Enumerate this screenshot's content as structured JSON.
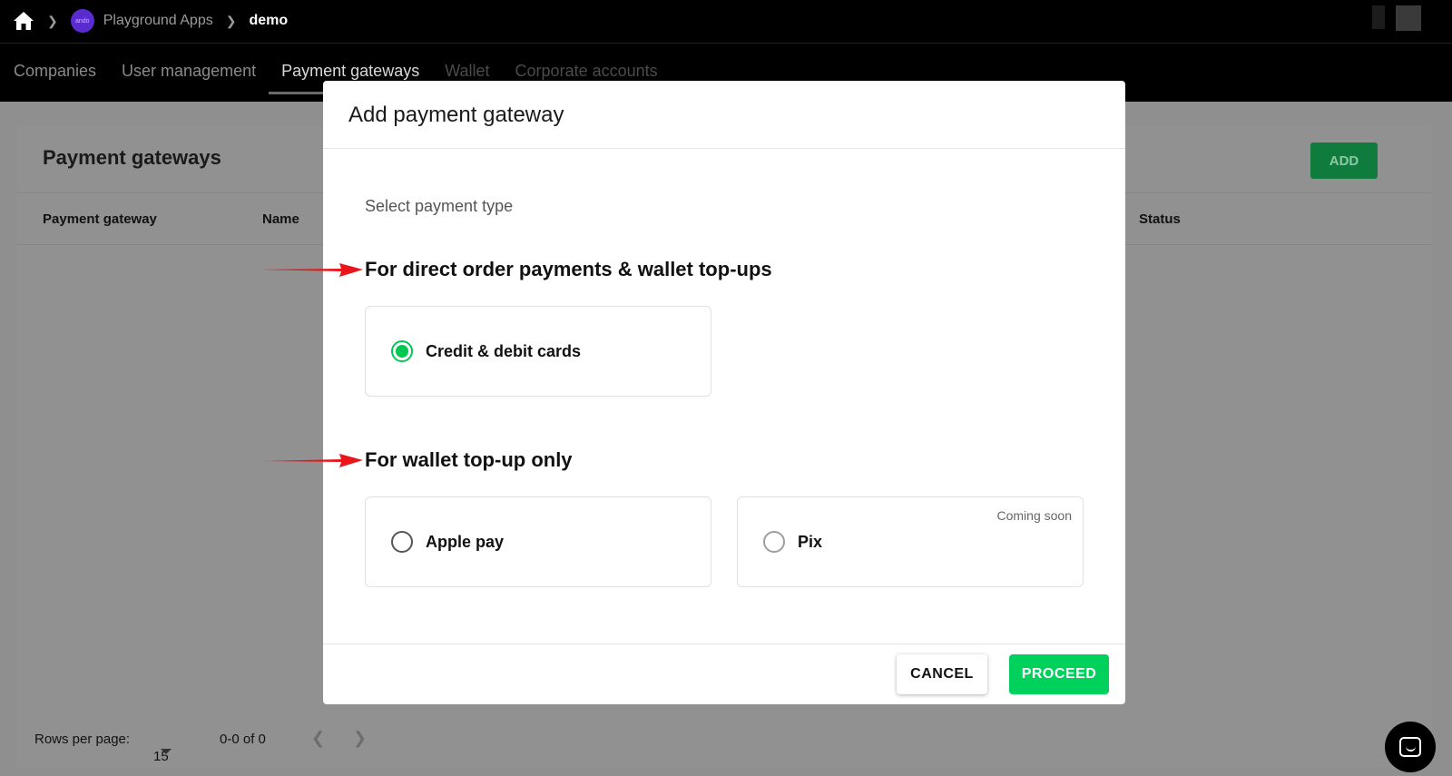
{
  "breadcrumb": {
    "home_icon": "home-icon",
    "org_name": "Playground Apps",
    "org_logo_text": "ando",
    "current": "demo"
  },
  "tabs": [
    "Companies",
    "User management",
    "Payment gateways",
    "Wallet",
    "Corporate accounts"
  ],
  "page": {
    "title": "Payment gateways",
    "add_label": "ADD",
    "columns": [
      "Payment gateway",
      "Name",
      "Status"
    ],
    "rows_per_page_label": "Rows per page:",
    "rows_per_page_value": "15",
    "range": "0-0 of 0",
    "prev_icon": "chevron-left-icon",
    "next_icon": "chevron-right-icon"
  },
  "modal": {
    "title": "Add payment gateway",
    "subtitle": "Select payment type",
    "section1": "For direct order payments & wallet top-ups",
    "section2": "For wallet top-up only",
    "options": [
      {
        "label": "Credit & debit cards",
        "selected": true,
        "badge": ""
      },
      {
        "label": "Apple pay",
        "selected": false,
        "badge": ""
      },
      {
        "label": "Pix",
        "selected": false,
        "badge": "Coming soon"
      }
    ],
    "cancel_label": "CANCEL",
    "proceed_label": "PROCEED"
  },
  "colors": {
    "accent": "#00d15c",
    "arrow": "#e8161b",
    "add_button": "#0f7c3e"
  },
  "chat_icon": "chat-icon"
}
